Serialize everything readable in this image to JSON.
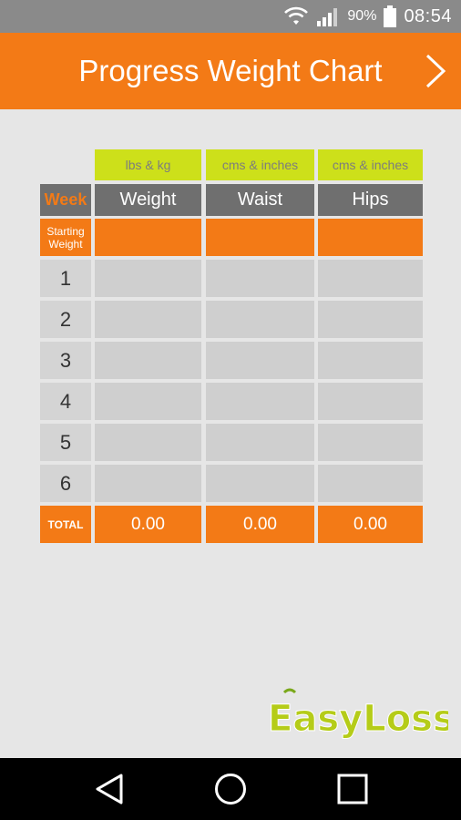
{
  "status_bar": {
    "battery_percent": "90%",
    "time": "08:54",
    "icons": [
      "wifi-icon",
      "signal-icon",
      "battery-icon"
    ]
  },
  "header": {
    "title": "Progress Weight Chart",
    "next_icon": "chevron-right-icon"
  },
  "table": {
    "units": [
      "lbs & kg",
      "cms & inches",
      "cms & inches"
    ],
    "week_label": "Week",
    "columns": [
      "Weight",
      "Waist",
      "Hips"
    ],
    "starting_label": "Starting Weight",
    "weeks": [
      "1",
      "2",
      "3",
      "4",
      "5",
      "6"
    ],
    "total_label": "TOTAL",
    "totals": [
      "0.00",
      "0.00",
      "0.00"
    ]
  },
  "logo": {
    "text": "EasyLoss"
  },
  "nav": {
    "icons": [
      "back-icon",
      "home-icon",
      "recents-icon"
    ]
  },
  "colors": {
    "accent": "#f37a16",
    "lime": "#cde01a",
    "header_grey": "#6f6f6f",
    "cell_grey": "#cfcfcf",
    "background": "#e6e6e6"
  }
}
